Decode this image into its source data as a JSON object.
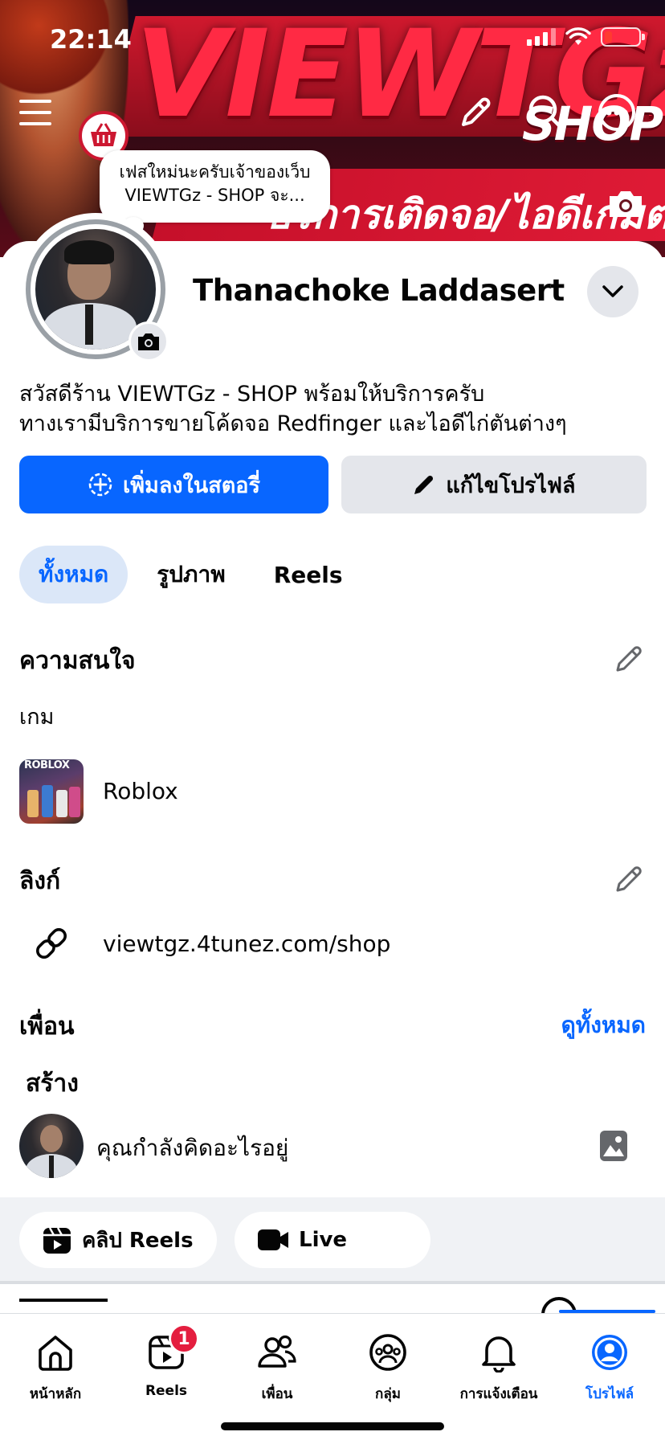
{
  "status_bar": {
    "time": "22:14"
  },
  "cover": {
    "brand_big": "VIEWTGz",
    "brand_shop": "SHOP",
    "subtitle": "บริการเติดจอ/ไอดีเกมต่าง"
  },
  "note": {
    "text": "เฟสใหม่นะครับเจ้าของเว็บ VIEWTGz - SHOP จะ..."
  },
  "profile": {
    "name": "Thanachoke Laddasert",
    "bio_line1": "สวัสดีร้าน VIEWTGz - SHOP พร้อมให้บริการครับ",
    "bio_line2": "ทางเรามีบริการขายโค้ดจอ Redfinger และไอดีไก่ตันต่างๆ"
  },
  "actions": {
    "add_story": "เพิ่มลงในสตอรี่",
    "edit_profile": "แก้ไขโปรไฟล์"
  },
  "tabs": [
    {
      "label": "ทั้งหมด",
      "active": true
    },
    {
      "label": "รูปภาพ",
      "active": false
    },
    {
      "label": "Reels",
      "active": false
    }
  ],
  "interests": {
    "title": "ความสนใจ",
    "category": "เกม",
    "item_name": "Roblox",
    "item_logo": "ROBLOX"
  },
  "links": {
    "title": "ลิงก์",
    "url": "viewtgz.4tunez.com/shop"
  },
  "friends": {
    "title": "เพื่อน",
    "see_all": "ดูทั้งหมด"
  },
  "create": {
    "title": "สร้าง",
    "composer_placeholder": "คุณกำลังคิดอะไรอยู่",
    "chip_reels": "คลิป Reels",
    "chip_live": "Live"
  },
  "bottom_nav": [
    {
      "label": "หน้าหลัก",
      "icon": "home-icon"
    },
    {
      "label": "Reels",
      "icon": "reels-icon",
      "badge": "1"
    },
    {
      "label": "เพื่อน",
      "icon": "friends-icon"
    },
    {
      "label": "กลุ่ม",
      "icon": "groups-icon"
    },
    {
      "label": "การแจ้งเตือน",
      "icon": "bell-icon"
    },
    {
      "label": "โปรไฟล์",
      "icon": "profile-icon",
      "active": true
    }
  ],
  "colors": {
    "accent": "#0866ff",
    "badge": "#e41e3f",
    "cover_red": "#d0192e"
  }
}
